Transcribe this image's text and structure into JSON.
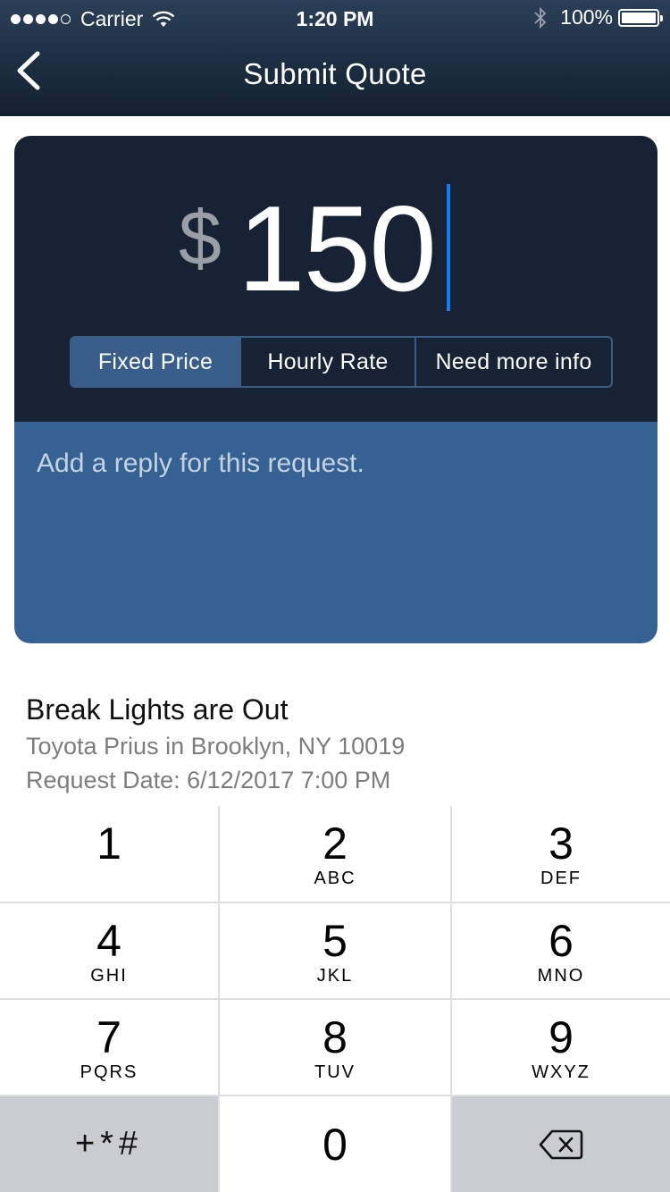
{
  "status_bar": {
    "carrier": "Carrier",
    "time": "1:20 PM",
    "battery": "100%"
  },
  "nav": {
    "title": "Submit Quote",
    "back_icon": "chevron-left-icon"
  },
  "quote": {
    "currency": "$",
    "amount": "150",
    "price_types": [
      {
        "label": "Fixed Price",
        "selected": true
      },
      {
        "label": "Hourly Rate",
        "selected": false
      },
      {
        "label": "Need more info",
        "selected": false
      }
    ],
    "reply_placeholder": "Add a reply for this request."
  },
  "request": {
    "title": "Break Lights are Out",
    "vehicle_location": "Toyota Prius in Brooklyn, NY 10019",
    "date": "Request Date: 6/12/2017 7:00 PM"
  },
  "keypad": {
    "keys": [
      {
        "num": "1",
        "letters": ""
      },
      {
        "num": "2",
        "letters": "ABC"
      },
      {
        "num": "3",
        "letters": "DEF"
      },
      {
        "num": "4",
        "letters": "GHI"
      },
      {
        "num": "5",
        "letters": "JKL"
      },
      {
        "num": "6",
        "letters": "MNO"
      },
      {
        "num": "7",
        "letters": "PQRS"
      },
      {
        "num": "8",
        "letters": "TUV"
      },
      {
        "num": "9",
        "letters": "WXYZ"
      }
    ],
    "symbols": "+*#",
    "zero": "0",
    "delete_icon": "backspace-icon"
  },
  "colors": {
    "header_dark": "#13202f",
    "card_dark": "#172334",
    "reply_blue": "#356293",
    "segment_active": "#3a5e8c",
    "caret": "#1a7bf0"
  }
}
